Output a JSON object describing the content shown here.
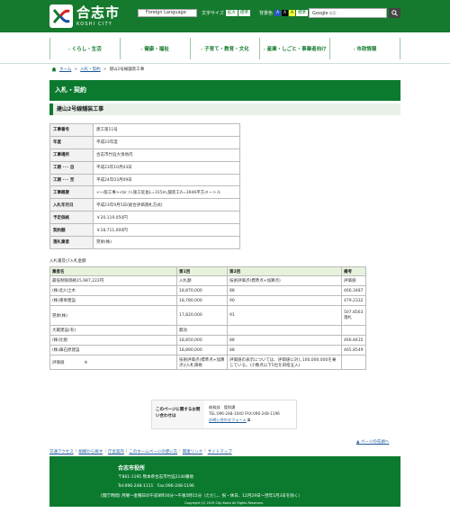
{
  "header": {
    "logo_jp": "合志市",
    "logo_en": "KOSHI CITY",
    "lang_select": "Foreign Language",
    "font_size_label": "文字サイズ",
    "font_enlarge": "拡大",
    "font_standard": "標準",
    "bg_color_label": "背景色",
    "bg_a1": "A",
    "bg_a2": "A",
    "bg_a3": "A",
    "bg_standard": "標準",
    "search_placeholder": "Google",
    "search_hint": "検索"
  },
  "nav": {
    "items": [
      "くらし・生活",
      "健康・福祉",
      "子育て・教育・文化",
      "産業・しごと・事業者向け",
      "市政情報"
    ]
  },
  "breadcrumb": {
    "home": "ホーム",
    "level1": "入札・契約",
    "current": "建山2号線舗装工事"
  },
  "page": {
    "title": "入札・契約",
    "subtitle": "建山2号線舗装工事"
  },
  "info_table": [
    {
      "key": "工事番号",
      "value": "建工第11号"
    },
    {
      "key": "年度",
      "value": "平成23年度"
    },
    {
      "key": "工事場所",
      "value": "合志市竹迫大湊地内"
    },
    {
      "key": "工期 ･･･ 自",
      "value": "平成23年10月03日"
    },
    {
      "key": "工期 ･･･ 至",
      "value": "平成24年03月09日"
    },
    {
      "key": "工事概要",
      "value": "<一般工事><br />施工延長L=315m,舗装工A=3946平方メートル"
    },
    {
      "key": "入札年月日",
      "value": "平成23年9月5日(総合評価落札方式)"
    },
    {
      "key": "予定価格",
      "value": "￥20,119,050円"
    },
    {
      "key": "契約額",
      "value": "￥18,711,000円"
    },
    {
      "key": "落札業者",
      "value": "晃栄(株)"
    }
  ],
  "bid_caption": "入札書及び入札金額",
  "bid_table": {
    "headers": [
      "業者名",
      "第1回",
      "第2回",
      "備考"
    ],
    "rows": [
      [
        "最低制限価格15,987,222円",
        "入札額",
        "技術評価点(標準点+加算点)",
        "評価値"
      ],
      [
        "(株)北川土木",
        "18,870,000",
        "88",
        "466.3487"
      ],
      [
        "(株)東栄建設",
        "18,780,000",
        "90",
        "479.2332"
      ],
      [
        "晃栄(株)",
        "17,820,000",
        "91",
        "507.8563 落札"
      ],
      [
        "大蔵建設(有)",
        "無効",
        "",
        ""
      ],
      [
        "(株)辻組",
        "18,850,000",
        "88",
        "466.8435"
      ],
      [
        "(株)鼻石原建設",
        "18,890,000",
        "88",
        "465.8549"
      ],
      [
        "評価値",
        "技術評価点(標準点+加算点)/入札価格",
        "評価値の表示については、評価値に対し100,000,000を乗じている。(小数点以下5位を四捨五入)",
        ""
      ]
    ],
    "eval_marker": "※"
  },
  "contact": {
    "label": "このページに関するお問い合わせは",
    "dept": "総務部　管財課",
    "tel": "TEL:096-248-1040 FAX:096-248-1196",
    "form_link": "お問い合わせフォーム"
  },
  "pagetop": "ページの先頭へ",
  "footer_links": [
    "交通アクセス",
    "組織から探す",
    "庁舎案内",
    "このホームページの使い方",
    "関連リンク",
    "サイトマップ"
  ],
  "footer": {
    "name": "合志市役所",
    "address": "〒861-1195  熊本県合志市竹迫2140番地",
    "tel": "Tel:096-248-1111　Fax:096-248-1196",
    "hours": "[開庁時間] 月曜～金曜日の午前8時30分～午後5時15分（ただし、祝・休日、12月29日～翌年1月3日を除く）",
    "copyright": "Copyright (C) 2019 City Koshi All Rights Reserved."
  },
  "colors": {
    "brand_green": "#157a2e",
    "title_green": "#0b7a2e",
    "table_header": "#e6f2dc"
  }
}
